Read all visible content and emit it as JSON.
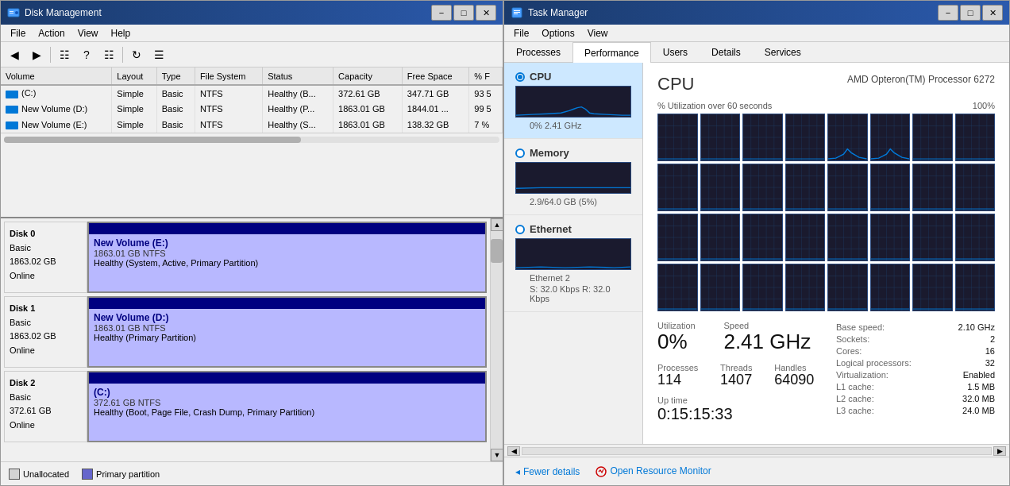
{
  "diskMgmt": {
    "title": "Disk Management",
    "menu": [
      "File",
      "Action",
      "View",
      "Help"
    ],
    "tableHeaders": [
      "Volume",
      "Layout",
      "Type",
      "File System",
      "Status",
      "Capacity",
      "Free Space",
      "% F"
    ],
    "volumes": [
      {
        "icon": true,
        "name": "(C:)",
        "layout": "Simple",
        "type": "Basic",
        "fs": "NTFS",
        "status": "Healthy (B...",
        "capacity": "372.61 GB",
        "free": "347.71 GB",
        "pct": "93 5"
      },
      {
        "icon": true,
        "name": "New Volume (D:)",
        "layout": "Simple",
        "type": "Basic",
        "fs": "NTFS",
        "status": "Healthy (P...",
        "capacity": "1863.01 GB",
        "free": "1844.01 ...",
        "pct": "99 5"
      },
      {
        "icon": true,
        "name": "New Volume (E:)",
        "layout": "Simple",
        "type": "Basic",
        "fs": "NTFS",
        "status": "Healthy (S...",
        "capacity": "1863.01 GB",
        "free": "138.32 GB",
        "pct": "7 %"
      }
    ],
    "disks": [
      {
        "id": "Disk 0",
        "type": "Basic",
        "size": "1863.02 GB",
        "status": "Online",
        "partitions": [
          {
            "name": "New Volume (E:)",
            "size": "1863.01 GB NTFS",
            "status": "Healthy (System, Active, Primary Partition)",
            "width": "100%"
          }
        ]
      },
      {
        "id": "Disk 1",
        "type": "Basic",
        "size": "1863.02 GB",
        "status": "Online",
        "partitions": [
          {
            "name": "New Volume (D:)",
            "size": "1863.01 GB NTFS",
            "status": "Healthy (Primary Partition)",
            "width": "100%"
          }
        ]
      },
      {
        "id": "Disk 2",
        "type": "Basic",
        "size": "372.61 GB",
        "status": "Online",
        "partitions": [
          {
            "name": "(C:)",
            "size": "372.61 GB NTFS",
            "status": "Healthy (Boot, Page File, Crash Dump, Primary Partition)",
            "width": "100%"
          }
        ]
      }
    ],
    "legend": {
      "unallocated": "Unallocated",
      "primary": "Primary partition"
    }
  },
  "taskMgr": {
    "title": "Task Manager",
    "menu": [
      "File",
      "Options",
      "View"
    ],
    "tabs": [
      "Processes",
      "Performance",
      "Users",
      "Details",
      "Services"
    ],
    "activeTab": "Performance",
    "sidebar": [
      {
        "id": "cpu",
        "label": "CPU",
        "value": "0%  2.41 GHz",
        "selected": true
      },
      {
        "id": "memory",
        "label": "Memory",
        "value": "2.9/64.0 GB (5%)"
      },
      {
        "id": "ethernet",
        "label": "Ethernet",
        "value2": "Ethernet 2",
        "value": "S: 32.0 Kbps  R: 32.0 Kbps"
      }
    ],
    "cpu": {
      "title": "CPU",
      "model": "AMD Opteron(TM) Processor 6272",
      "utilLabel": "% Utilization over 60 seconds",
      "utilMax": "100%",
      "utilization": "0%",
      "speed": "2.41 GHz",
      "processes": "114",
      "threads": "1407",
      "handles": "64090",
      "uptime": "0:15:15:33",
      "baseSpeed": "2.10 GHz",
      "sockets": "2",
      "cores": "16",
      "logicalProcs": "32",
      "virtualization": "Enabled",
      "l1cache": "1.5 MB",
      "l2cache": "32.0 MB",
      "l3cache": "24.0 MB",
      "labels": {
        "utilization": "Utilization",
        "speed": "Speed",
        "processes": "Processes",
        "threads": "Threads",
        "handles": "Handles",
        "uptime": "Up time",
        "baseSpeed": "Base speed:",
        "sockets": "Sockets:",
        "cores": "Cores:",
        "logicalProcs": "Logical processors:",
        "virtualization": "Virtualization:",
        "l1": "L1 cache:",
        "l2": "L2 cache:",
        "l3": "L3 cache:"
      }
    },
    "bottom": {
      "fewerDetails": "Fewer details",
      "openResourceMonitor": "Open Resource Monitor"
    }
  }
}
